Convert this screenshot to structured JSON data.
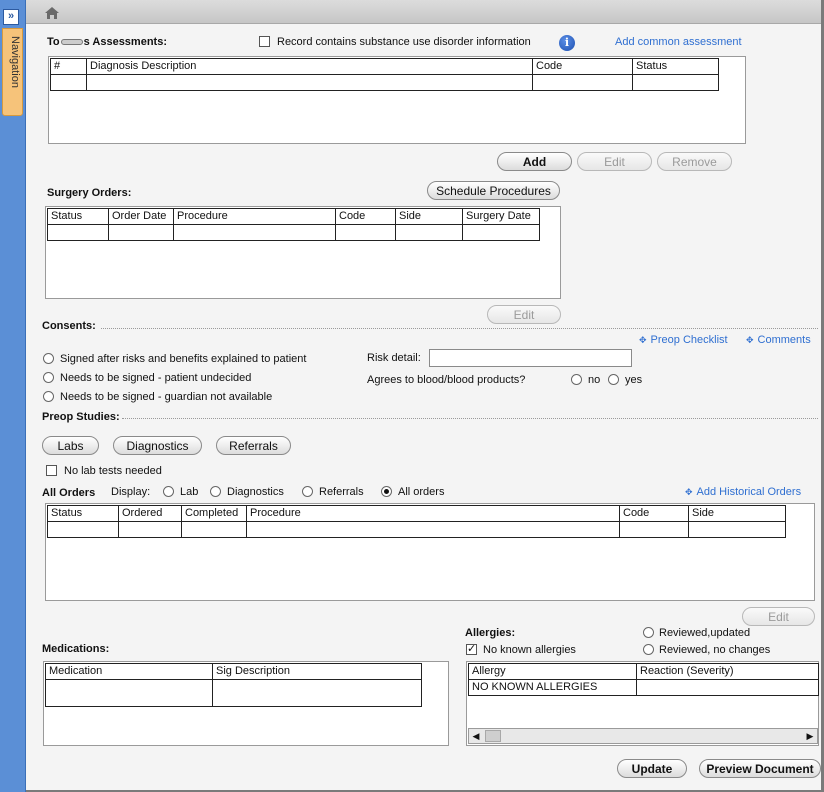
{
  "nav": {
    "expand_glyph": "»",
    "label": "Navigation"
  },
  "header": {
    "home_icon": "home-icon"
  },
  "assessments": {
    "title_part1": "To",
    "title_part2": "s Assessments:",
    "substance_checkbox_label": "Record contains substance use disorder information",
    "substance_checked": false,
    "add_common_link": "Add common assessment",
    "columns": [
      "#",
      "Diagnosis Description",
      "Code",
      "Status"
    ],
    "buttons": {
      "add": "Add",
      "edit": "Edit",
      "remove": "Remove"
    }
  },
  "surgery_orders": {
    "title": "Surgery Orders:",
    "schedule_button": "Schedule Procedures",
    "columns": [
      "Status",
      "Order Date",
      "Procedure",
      "Code",
      "Side",
      "Surgery Date"
    ],
    "edit_button": "Edit"
  },
  "consents": {
    "title": "Consents:",
    "preop_checklist_link": "Preop Checklist",
    "comments_link": "Comments",
    "options": [
      "Signed after risks and benefits explained to  patient",
      "Needs to be signed - patient undecided",
      "Needs to be signed - guardian not  available"
    ],
    "risk_detail_label": "Risk detail:",
    "risk_detail_value": "",
    "blood_label": "Agrees to blood/blood products?",
    "blood_no": "no",
    "blood_yes": "yes"
  },
  "preop_studies": {
    "title": "Preop Studies:",
    "buttons": {
      "labs": "Labs",
      "diagnostics": "Diagnostics",
      "referrals": "Referrals"
    },
    "no_lab_label": "No lab tests needed"
  },
  "all_orders": {
    "title": "All Orders",
    "display_label": "Display:",
    "display_options": [
      "Lab",
      "Diagnostics",
      "Referrals",
      "All orders"
    ],
    "selected_option": "All orders",
    "add_historical_link": "Add Historical Orders",
    "columns": [
      "Status",
      "Ordered",
      "Completed",
      "Procedure",
      "Code",
      "Side"
    ],
    "edit_button": "Edit"
  },
  "medications": {
    "title": "Medications:",
    "columns": [
      "Medication",
      "Sig Description"
    ]
  },
  "allergies": {
    "title": "Allergies:",
    "no_known_label": "No known allergies",
    "no_known_checked": true,
    "reviewed_updated": "Reviewed,updated",
    "reviewed_no_changes": "Reviewed, no changes",
    "columns": [
      "Allergy",
      "Reaction (Severity)"
    ],
    "rows": [
      [
        "NO KNOWN ALLERGIES",
        ""
      ]
    ]
  },
  "footer": {
    "update_button": "Update",
    "preview_button": "Preview Document"
  }
}
